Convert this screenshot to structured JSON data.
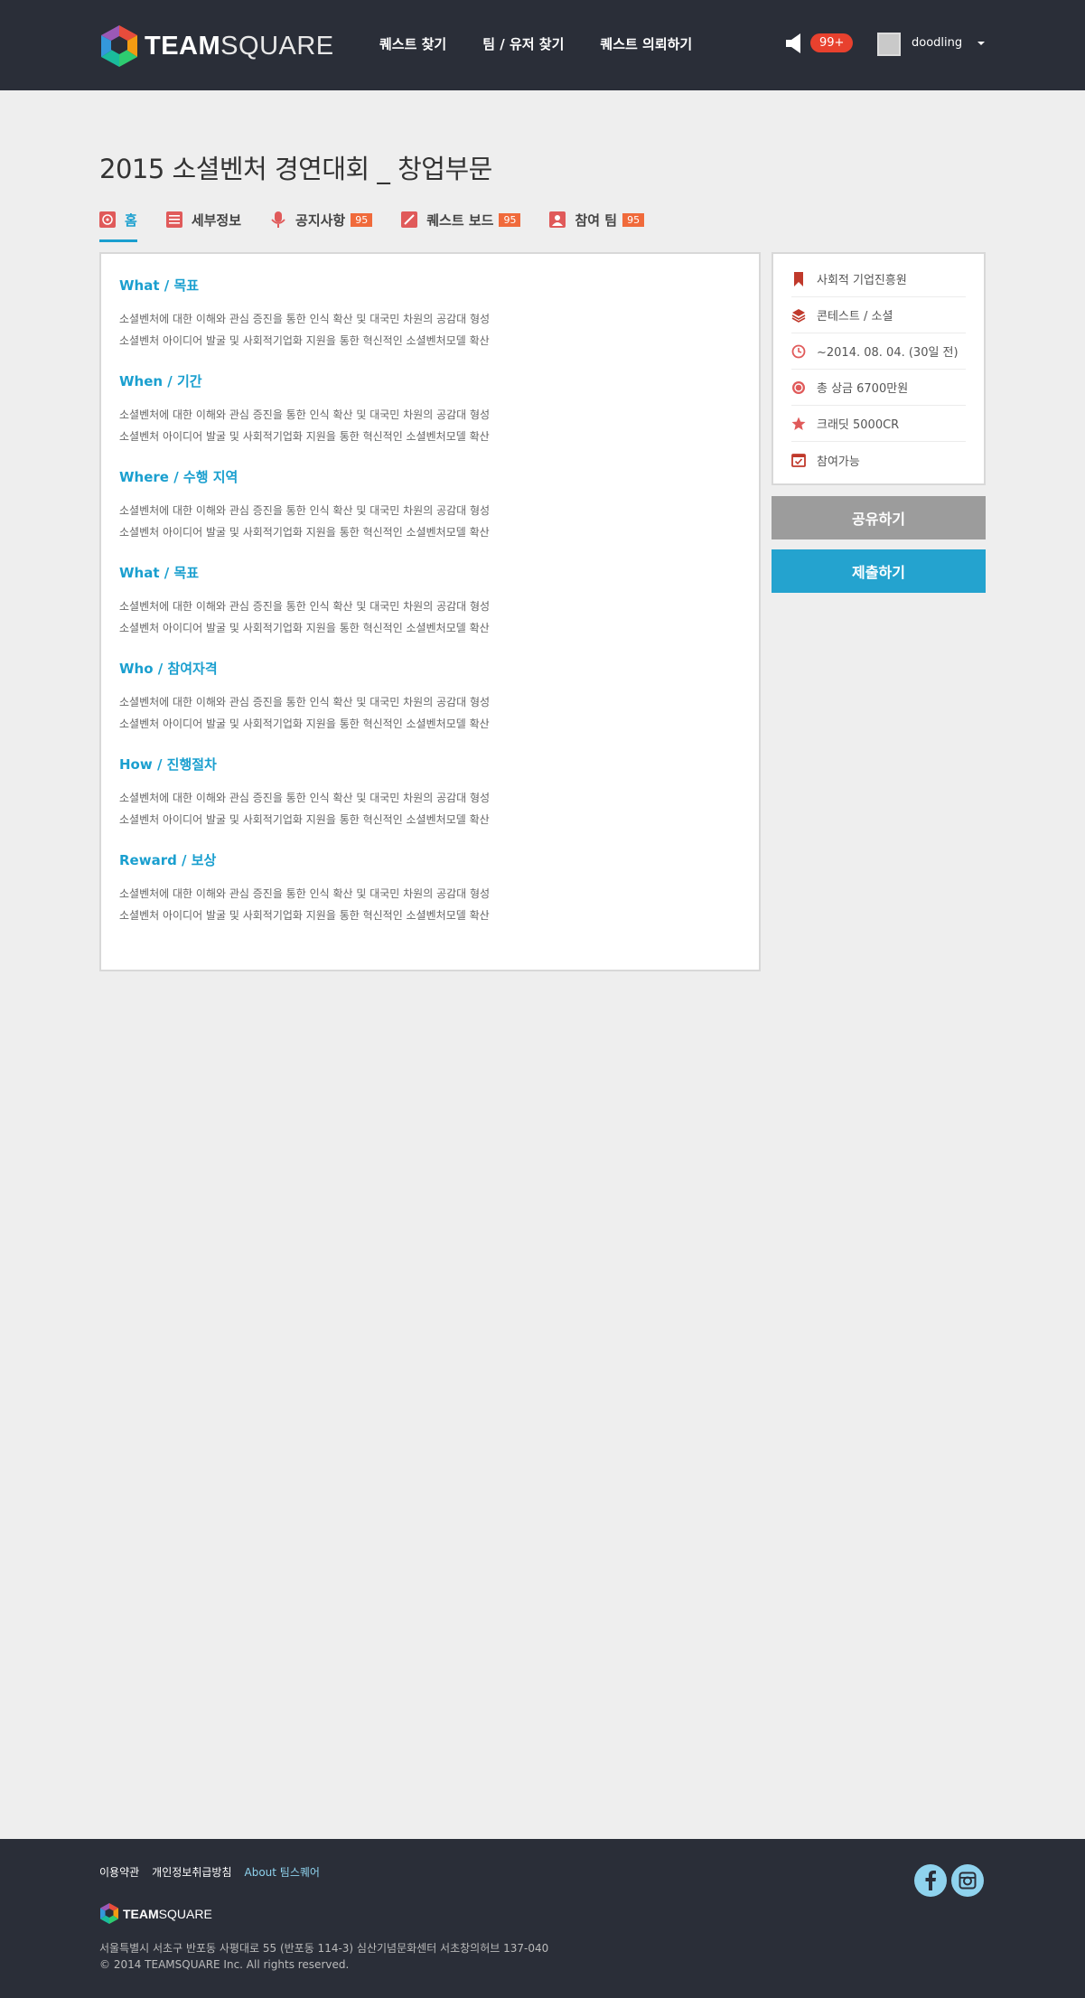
{
  "header": {
    "brand_bold": "TEAM",
    "brand_light": "SQUARE",
    "nav": [
      "퀘스트 찾기",
      "팀 / 유저 찾기",
      "퀘스트 의뢰하기"
    ],
    "notification_count": "99+",
    "username": "doodling"
  },
  "page": {
    "title": "2015 소셜벤처 경연대회 _ 창업부문",
    "tabs": [
      {
        "label": "홈",
        "icon": "home-icon",
        "active": true
      },
      {
        "label": "세부정보",
        "icon": "list-icon"
      },
      {
        "label": "공지사항",
        "icon": "microphone-icon",
        "badge": "95"
      },
      {
        "label": "퀘스트 보드",
        "icon": "edit-icon",
        "badge": "95"
      },
      {
        "label": "참여 팀",
        "icon": "user-icon",
        "badge": "95"
      }
    ]
  },
  "sections": [
    {
      "title": "What / 목표",
      "line1": "소셜벤처에 대한 이해와 관심 증진을 통한 인식 확산 및 대국민 차원의 공감대 형성",
      "line2": "소셜벤처 아이디어 발굴 및 사회적기업화 지원을 통한 혁신적인 소셜벤처모델 확산"
    },
    {
      "title": "When / 기간",
      "line1": "소셜벤처에 대한 이해와 관심 증진을 통한 인식 확산 및 대국민 차원의 공감대 형성",
      "line2": "소셜벤처 아이디어 발굴 및 사회적기업화 지원을 통한 혁신적인 소셜벤처모델 확산"
    },
    {
      "title": "Where / 수행 지역",
      "line1": "소셜벤처에 대한 이해와 관심 증진을 통한 인식 확산 및 대국민 차원의 공감대 형성",
      "line2": "소셜벤처 아이디어 발굴 및 사회적기업화 지원을 통한 혁신적인 소셜벤처모델 확산"
    },
    {
      "title": "What / 목표",
      "line1": "소셜벤처에 대한 이해와 관심 증진을 통한 인식 확산 및 대국민 차원의 공감대 형성",
      "line2": "소셜벤처 아이디어 발굴 및 사회적기업화 지원을 통한 혁신적인 소셜벤처모델 확산"
    },
    {
      "title": "Who / 참여자격",
      "line1": "소셜벤처에 대한 이해와 관심 증진을 통한 인식 확산 및 대국민 차원의 공감대 형성",
      "line2": "소셜벤처 아이디어 발굴 및 사회적기업화 지원을 통한 혁신적인 소셜벤처모델 확산"
    },
    {
      "title": "How / 진행절차",
      "line1": "소셜벤처에 대한 이해와 관심 증진을 통한 인식 확산 및 대국민 차원의 공감대 형성",
      "line2": "소셜벤처 아이디어 발굴 및 사회적기업화 지원을 통한 혁신적인 소셜벤처모델 확산"
    },
    {
      "title": "Reward / 보상",
      "line1": "소셜벤처에 대한 이해와 관심 증진을 통한 인식 확산 및 대국민 차원의 공감대 형성",
      "line2": "소셜벤처 아이디어 발굴 및 사회적기업화 지원을 통한 혁신적인 소셜벤처모델 확산"
    }
  ],
  "info": [
    {
      "label": "사회적 기업진흥원",
      "icon": "bookmark-icon"
    },
    {
      "label": "콘테스트 / 소셜",
      "icon": "layers-icon"
    },
    {
      "label": "~2014. 08. 04. (30일 전)",
      "icon": "clock-icon"
    },
    {
      "label": "총 상금 6700만원",
      "icon": "coin-icon"
    },
    {
      "label": "크래딧 5000CR",
      "icon": "star-icon"
    },
    {
      "label": "참여가능",
      "icon": "calendar-check-icon"
    }
  ],
  "buttons": {
    "share": "공유하기",
    "submit": "제출하기"
  },
  "footer": {
    "links": [
      "이용약관",
      "개인정보취급방침",
      "About 팀스퀘어"
    ],
    "brand_bold": "TEAM",
    "brand_light": "SQUARE",
    "address": "서울특별시 서초구 반포동 사평대로 55 (반포동 114-3) 심산기념문화센터 서초창의허브 137-040",
    "copyright": "© 2014 TEAMSQUARE Inc. All rights reserved."
  },
  "colors": {
    "accent": "#1a9fcf",
    "header_bg": "#2a2e38",
    "badge": "#f06a3b",
    "notification": "#e8412e",
    "icon_red": "#e05a5a"
  }
}
